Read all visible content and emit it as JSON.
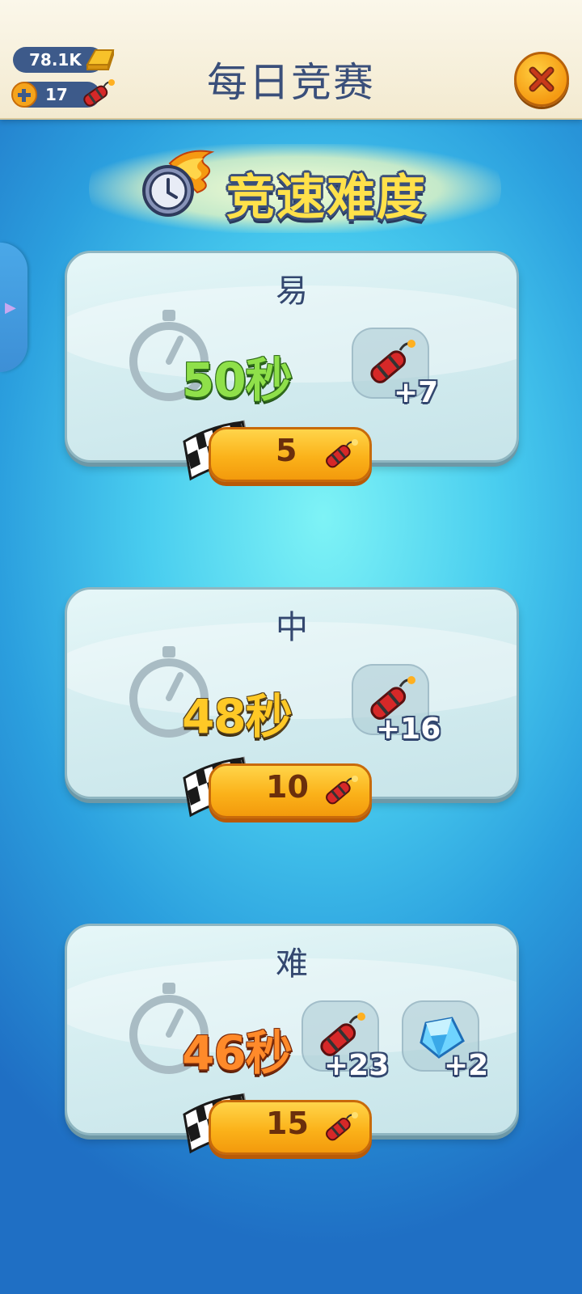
{
  "header": {
    "title": "每日竞赛",
    "gold": "78.1K",
    "dynamite": "17"
  },
  "banner": {
    "text": "竞速难度"
  },
  "levels": [
    {
      "name": "易",
      "time": "50秒",
      "rewards": [
        "+7"
      ],
      "cost": "5"
    },
    {
      "name": "中",
      "time": "48秒",
      "rewards": [
        "+16"
      ],
      "cost": "10"
    },
    {
      "name": "难",
      "time": "46秒",
      "rewards": [
        "+23",
        "+2"
      ],
      "cost": "15"
    }
  ],
  "icons": {
    "gold": "gold-bar-icon",
    "dynamite": "dynamite-icon",
    "gem": "diamond-icon",
    "flag": "checkered-flag-icon",
    "close": "close-icon",
    "clock": "flaming-clock-icon",
    "stopwatch": "stopwatch-icon"
  },
  "colors": {
    "easy_time": "#8fe04a",
    "medium_time": "#ffc926",
    "hard_time": "#ff8a2a",
    "button": "#fbb21a",
    "title": "#3a4f7a"
  }
}
